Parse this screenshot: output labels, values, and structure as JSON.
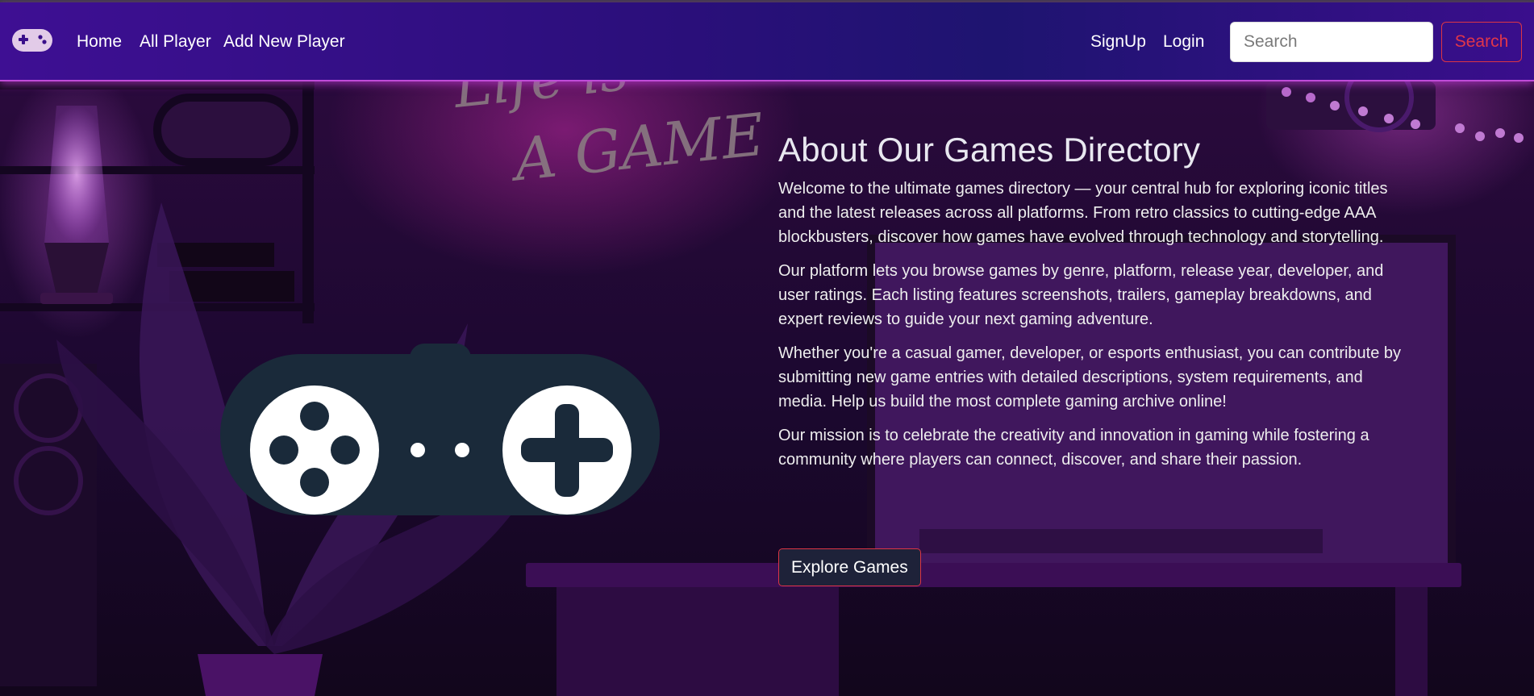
{
  "navbar": {
    "brand_icon": "gamepad-icon",
    "links": [
      "Home",
      "All Player",
      "Add New Player"
    ],
    "signup_label": "SignUp",
    "login_label": "Login",
    "search": {
      "placeholder": "Search",
      "button_label": "Search"
    }
  },
  "hero": {
    "background_sign": "Life is A Game",
    "title": "About Our Games Directory",
    "paragraphs": [
      "Welcome to the ultimate games directory — your central hub for exploring iconic titles and the latest releases across all platforms. From retro classics to cutting-edge AAA blockbusters, discover how games have evolved through technology and storytelling.",
      "Our platform lets you browse games by genre, platform, release year, developer, and user ratings. Each listing features screenshots, trailers, gameplay breakdowns, and expert reviews to guide your next gaming adventure.",
      "Whether you're a casual gamer, developer, or esports enthusiast, you can contribute by submitting new game entries with detailed descriptions, system requirements, and media. Help us build the most complete gaming archive online!",
      "Our mission is to celebrate the creativity and innovation in gaming while fostering a community where players can connect, discover, and share their passion."
    ],
    "cta_label": "Explore Games",
    "illustration_icon": "gamepad-icon"
  },
  "colors": {
    "navbar": "#2a0f7a",
    "accent_red": "#dc3545",
    "button_bg": "#1e2239",
    "controller": "#1a2a3a"
  }
}
